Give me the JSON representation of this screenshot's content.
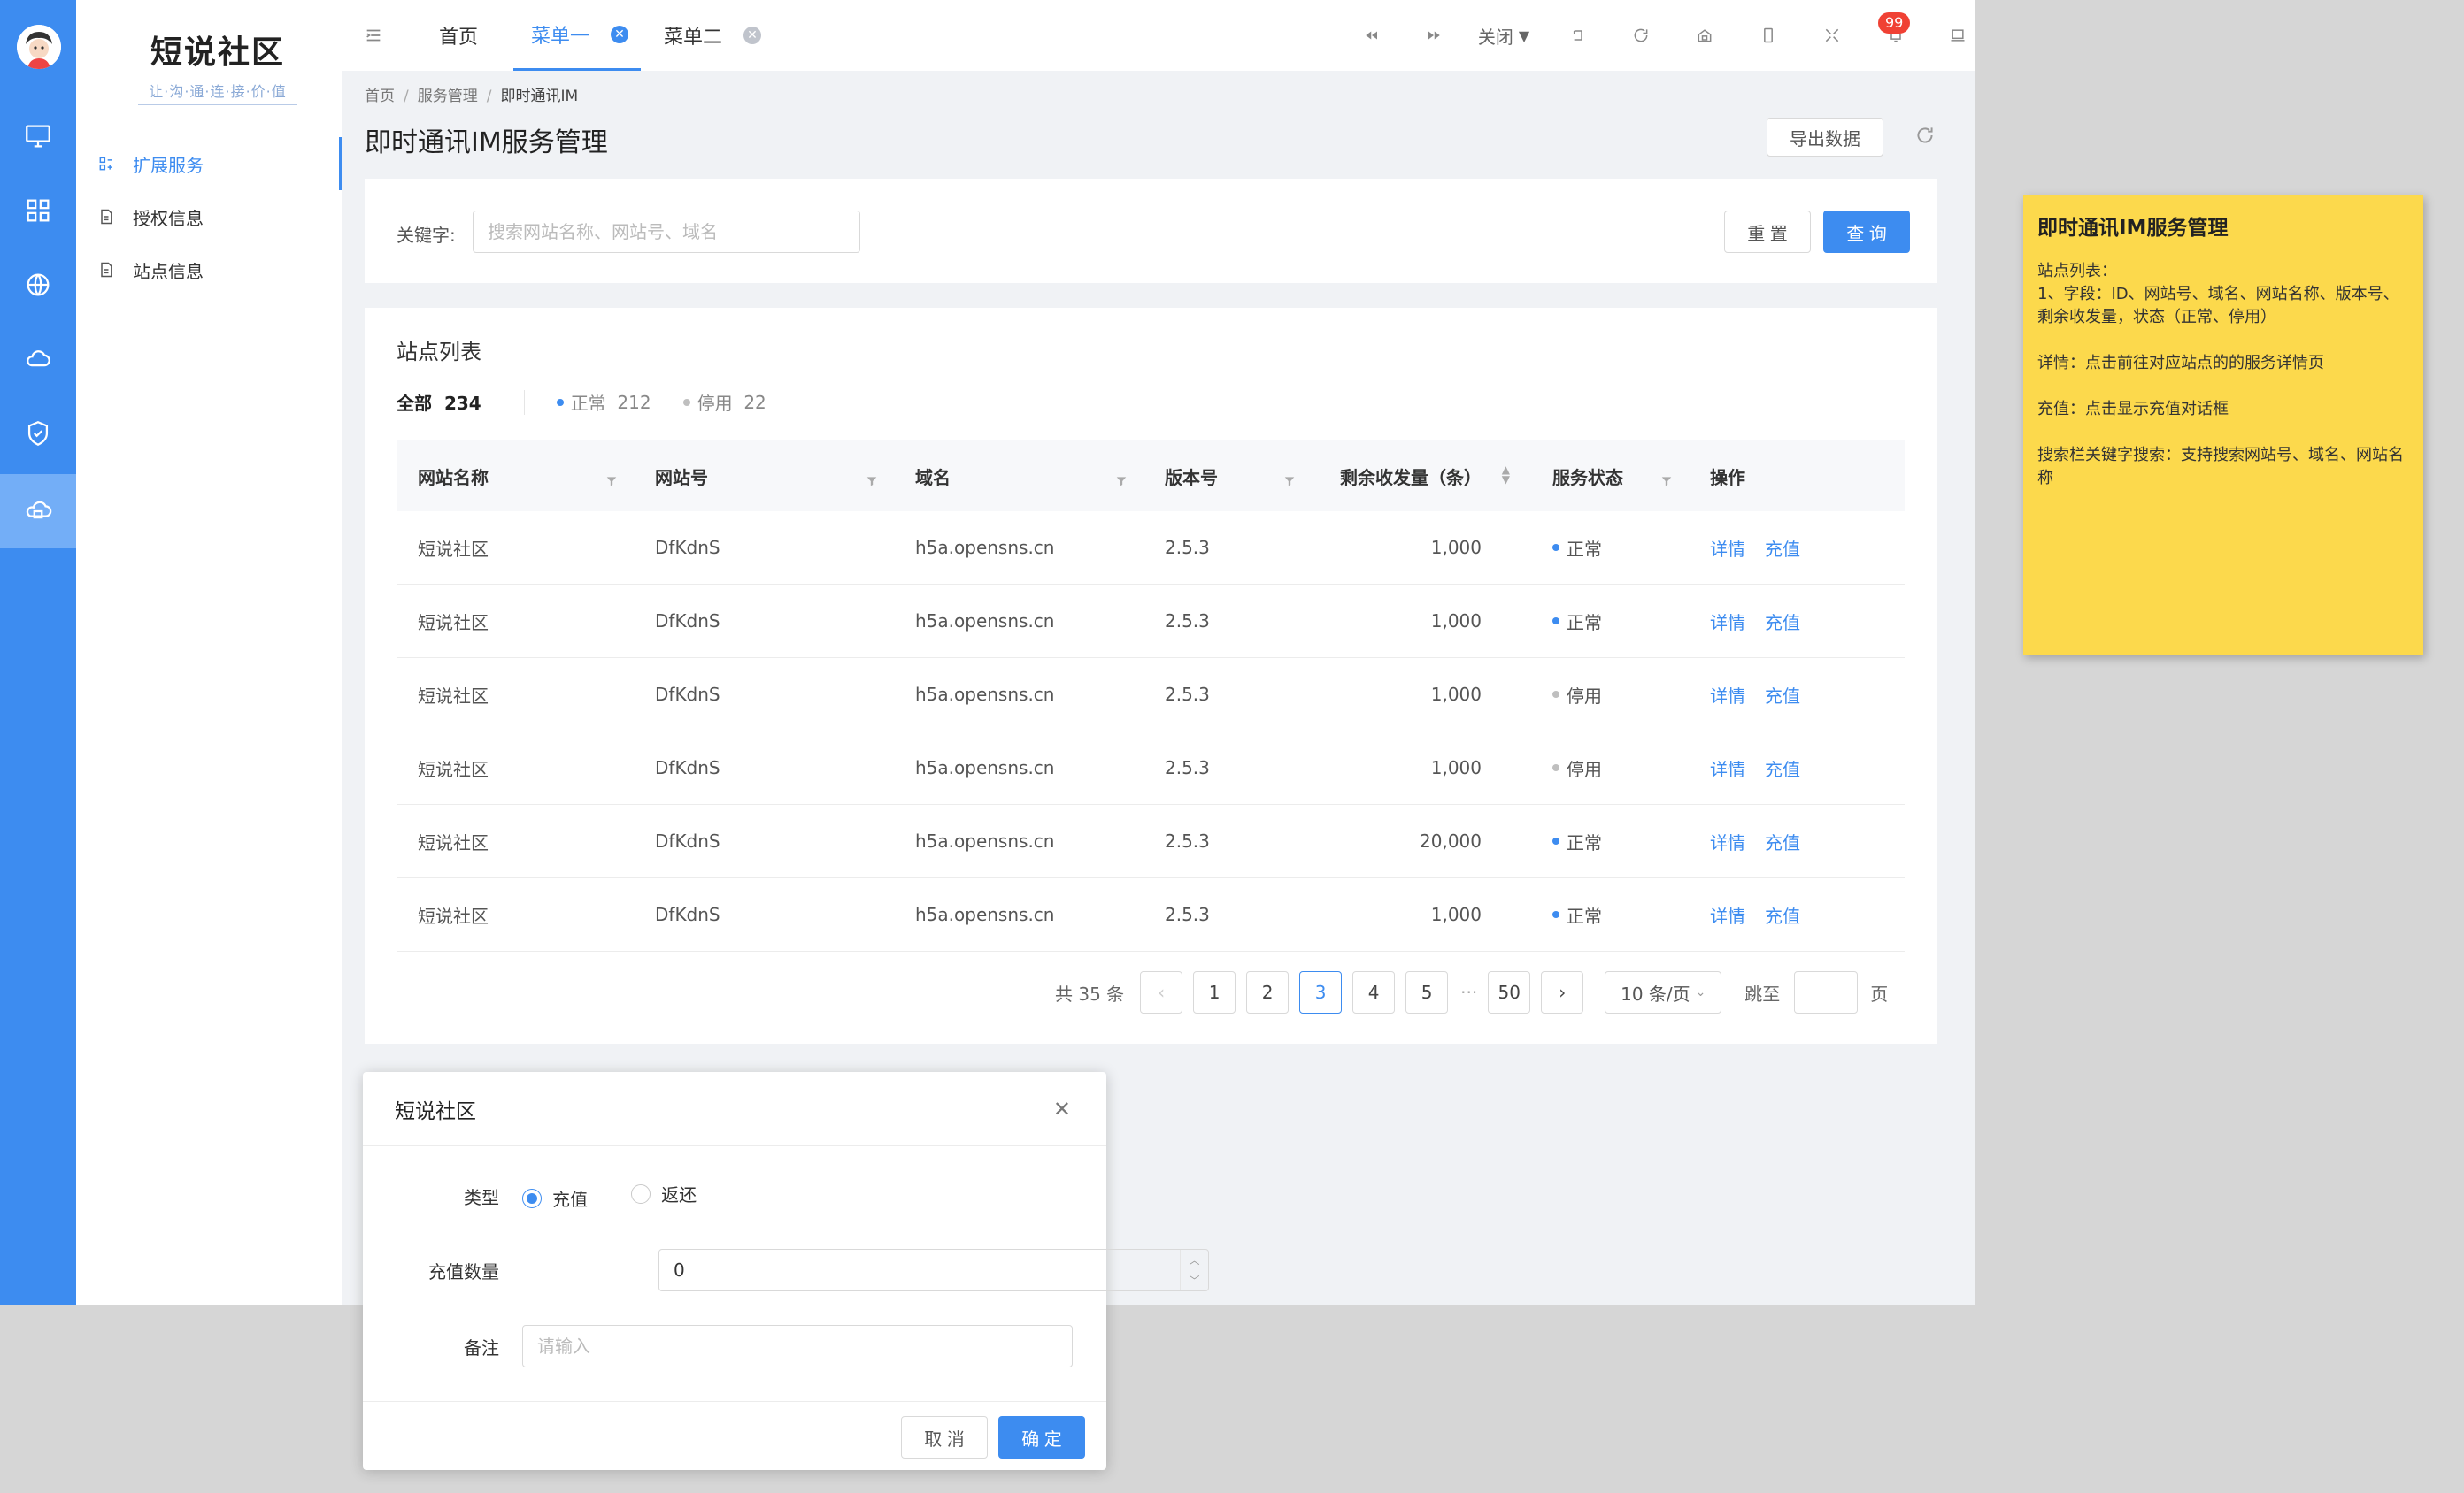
{
  "sidebar": {
    "avatar_alt": "user avatar",
    "rail_icons": [
      "monitor-icon",
      "grid-icon",
      "globe-icon",
      "cloud-icon",
      "shield-check-icon",
      "cloud-service-icon"
    ],
    "logo_title": "短说社区",
    "logo_sub": "让·沟·通·连·接·价·值",
    "items": [
      {
        "label": "扩展服务",
        "icon": "extension-icon",
        "active": true
      },
      {
        "label": "授权信息",
        "icon": "document-icon",
        "active": false
      },
      {
        "label": "站点信息",
        "icon": "document-icon",
        "active": false
      }
    ]
  },
  "topbar": {
    "tabs": [
      {
        "label": "首页",
        "closable": false
      },
      {
        "label": "菜单一",
        "closable": true,
        "active": true
      },
      {
        "label": "菜单二",
        "closable": true
      }
    ],
    "close_label": "关闭",
    "notification_count": "99"
  },
  "breadcrumb": [
    "首页",
    "服务管理",
    "即时通讯IM"
  ],
  "page": {
    "title": "即时通讯IM服务管理",
    "export_label": "导出数据"
  },
  "search": {
    "label": "关键字:",
    "placeholder": "搜索网站名称、网站号、域名",
    "reset_label": "重 置",
    "query_label": "查 询"
  },
  "list": {
    "title": "站点列表",
    "all_label": "全部",
    "all_count": "234",
    "normal_label": "正常",
    "normal_count": "212",
    "stopped_label": "停用",
    "stopped_count": "22",
    "columns": [
      "网站名称",
      "网站号",
      "域名",
      "版本号",
      "剩余收发量（条）",
      "服务状态",
      "操作"
    ],
    "rows": [
      {
        "name": "短说社区",
        "code": "DfKdnS",
        "domain": "h5a.opensns.cn",
        "version": "2.5.3",
        "remaining": "1,000",
        "status": "正常",
        "active": true
      },
      {
        "name": "短说社区",
        "code": "DfKdnS",
        "domain": "h5a.opensns.cn",
        "version": "2.5.3",
        "remaining": "1,000",
        "status": "正常",
        "active": true
      },
      {
        "name": "短说社区",
        "code": "DfKdnS",
        "domain": "h5a.opensns.cn",
        "version": "2.5.3",
        "remaining": "1,000",
        "status": "停用",
        "active": false
      },
      {
        "name": "短说社区",
        "code": "DfKdnS",
        "domain": "h5a.opensns.cn",
        "version": "2.5.3",
        "remaining": "1,000",
        "status": "停用",
        "active": false
      },
      {
        "name": "短说社区",
        "code": "DfKdnS",
        "domain": "h5a.opensns.cn",
        "version": "2.5.3",
        "remaining": "20,000",
        "status": "正常",
        "active": true
      },
      {
        "name": "短说社区",
        "code": "DfKdnS",
        "domain": "h5a.opensns.cn",
        "version": "2.5.3",
        "remaining": "1,000",
        "status": "正常",
        "active": true
      }
    ],
    "action_detail": "详情",
    "action_recharge": "充值"
  },
  "pagination": {
    "total_text": "共 35 条",
    "pages": [
      "1",
      "2",
      "3",
      "4",
      "5"
    ],
    "current": "3",
    "ellipsis": "···",
    "last": "50",
    "page_size": "10 条/页",
    "jump_label": "跳至",
    "page_unit": "页"
  },
  "modal": {
    "title": "短说社区",
    "type_label": "类型",
    "type_options": [
      "充值",
      "返还"
    ],
    "type_selected": "充值",
    "amount_label": "充值数量",
    "amount_value": "0",
    "remark_label": "备注",
    "remark_placeholder": "请输入",
    "cancel_label": "取 消",
    "ok_label": "确 定"
  },
  "note": {
    "title": "即时通讯IM服务管理",
    "paragraphs": [
      "站点列表：\n1、字段：ID、网站号、域名、网站名称、版本号、剩余收发量，状态（正常、停用）",
      "详情：点击前往对应站点的的服务详情页",
      "充值：点击显示充值对话框",
      "搜索栏关键字搜索：支持搜索网站号、域名、网站名称"
    ]
  },
  "colors": {
    "primary": "#3d8cf0",
    "note_bg": "#fcd94c"
  }
}
